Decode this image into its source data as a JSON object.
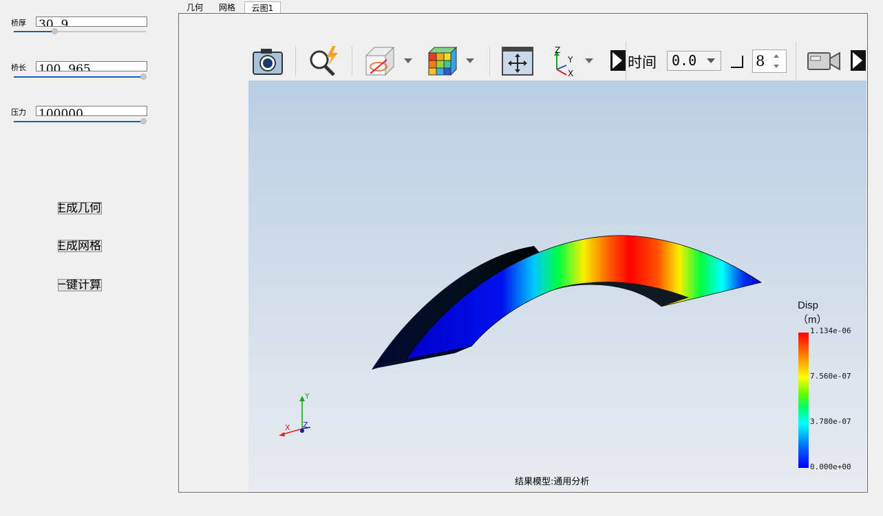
{
  "params": [
    {
      "label": "桥厚",
      "value": "30. 9",
      "slider_fraction": 0.31
    },
    {
      "label": "桥长",
      "value": "100. 965",
      "slider_fraction": 1.0
    },
    {
      "label": "压力",
      "value": "100000",
      "slider_fraction": 1.0
    }
  ],
  "actions": {
    "gen_geometry": "生成几何",
    "gen_mesh": "生成网格",
    "one_click": "一键计算"
  },
  "tabs": [
    "几何",
    "网格",
    "云图1"
  ],
  "active_tab": "云图1",
  "toolbar": {
    "icons": [
      "camera-icon",
      "zoom-flash-icon",
      "box-visibility-icon",
      "color-cube-icon",
      "fit-view-icon",
      "axes-orientation-icon",
      "collapse-arrow-icon",
      "video-camera-icon",
      "collapse-arrow-icon"
    ],
    "time_label": "时间",
    "time_value": "0.0",
    "step_value": "8"
  },
  "legend": {
    "title": "Disp",
    "unit": "（m）",
    "ticks": [
      "1.134e-06",
      "7.560e-07",
      "3.780e-07",
      "0.000e+00"
    ],
    "colors": [
      "#ff0000",
      "#ffff00",
      "#00ff00",
      "#00ffff",
      "#0000ff"
    ]
  },
  "axes": {
    "x": "X",
    "y": "Y",
    "z": "Z"
  },
  "status": "结果模型:通用分析"
}
